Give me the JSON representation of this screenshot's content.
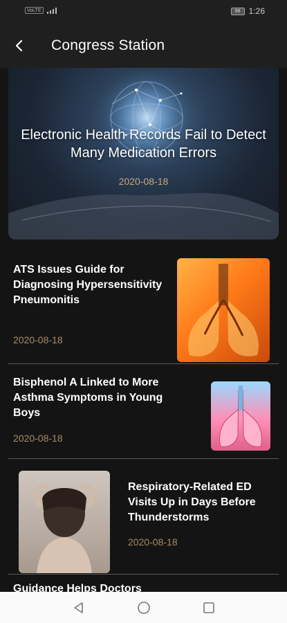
{
  "status_bar": {
    "left_chip": "VoLTE",
    "clock": "1:26",
    "battery": "88"
  },
  "app_bar": {
    "title": "Congress Station"
  },
  "hero": {
    "title": "Electronic Health Records Fail to Detect Many Medication Errors",
    "date": "2020-08-18"
  },
  "articles": [
    {
      "title": "ATS Issues Guide for Diagnosing Hypersensitivity Pneumonitis",
      "date": "2020-08-18"
    },
    {
      "title": "Bisphenol A Linked to More Asthma Symptoms in Young Boys",
      "date": "2020-08-18"
    },
    {
      "title": "Respiratory-Related ED Visits Up in Days Before Thunderstorms",
      "date": "2020-08-18"
    },
    {
      "title": "Guidance Helps Doctors"
    }
  ],
  "icons": {
    "back": "chevron-left-icon",
    "nav_back": "triangle-back-icon",
    "nav_home": "circle-home-icon",
    "nav_recents": "square-recents-icon"
  }
}
